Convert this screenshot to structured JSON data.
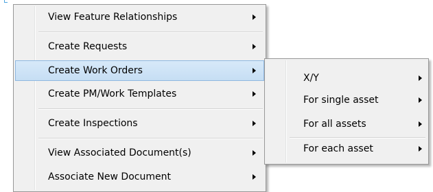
{
  "main_menu": {
    "items": [
      {
        "label": "View Feature Relationships",
        "has_submenu": true,
        "highlighted": false
      },
      {
        "label": "Create Requests",
        "has_submenu": true,
        "highlighted": false
      },
      {
        "label": "Create Work Orders",
        "has_submenu": true,
        "highlighted": true
      },
      {
        "label": "Create PM/Work Templates",
        "has_submenu": true,
        "highlighted": false
      },
      {
        "label": "Create Inspections",
        "has_submenu": true,
        "highlighted": false
      },
      {
        "label": "View Associated Document(s)",
        "has_submenu": true,
        "highlighted": false
      },
      {
        "label": "Associate New Document",
        "has_submenu": true,
        "highlighted": false
      }
    ]
  },
  "submenu": {
    "parent": "Create Work Orders",
    "items": [
      {
        "label": "X/Y",
        "has_submenu": true
      },
      {
        "label": "For single asset",
        "has_submenu": true
      },
      {
        "label": "For all assets",
        "has_submenu": true
      },
      {
        "label": "For each asset",
        "has_submenu": true
      }
    ]
  },
  "colors": {
    "menu_background": "#f0f0f0",
    "menu_border": "#979797",
    "highlight_fill": "#cde4f7",
    "highlight_border": "#8eb7e0",
    "separator": "#d4d4d4"
  },
  "icons": {
    "submenu_indicator": "chevron-right-icon"
  }
}
